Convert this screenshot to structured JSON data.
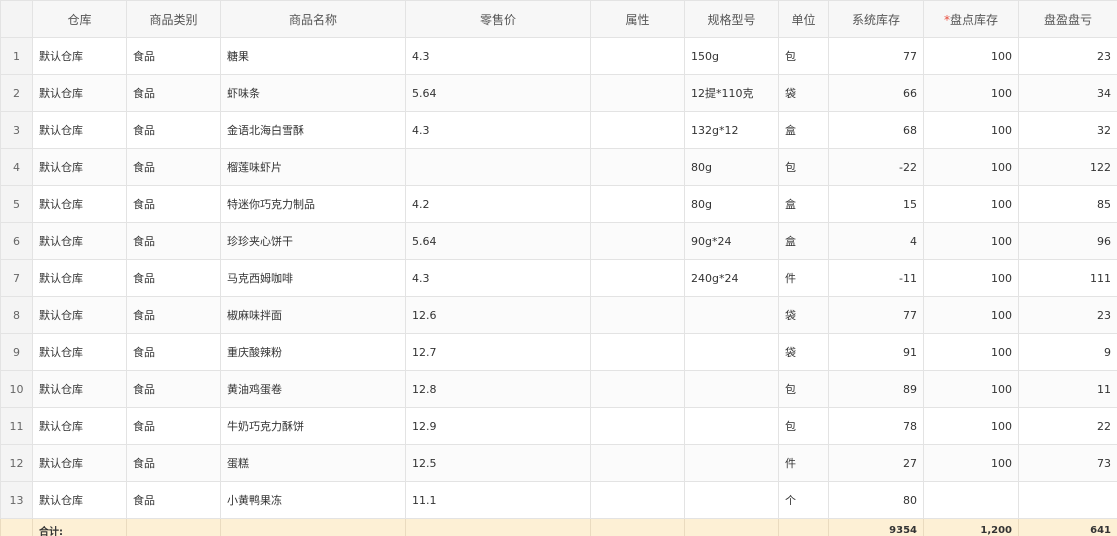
{
  "headers": {
    "warehouse": "仓库",
    "category": "商品类别",
    "name": "商品名称",
    "price": "零售价",
    "attribute": "属性",
    "spec": "规格型号",
    "unit": "单位",
    "system_stock": "系统库存",
    "required_mark": "*",
    "count_stock": "盘点库存",
    "diff": "盘盈盘亏"
  },
  "rows": [
    {
      "n": "1",
      "warehouse": "默认仓库",
      "category": "食品",
      "name": "糖果",
      "price": "4.3",
      "attribute": "",
      "spec": "150g",
      "unit": "包",
      "system_stock": "77",
      "count_stock": "100",
      "diff": "23"
    },
    {
      "n": "2",
      "warehouse": "默认仓库",
      "category": "食品",
      "name": "虾味条",
      "price": "5.64",
      "attribute": "",
      "spec": "12提*110克",
      "unit": "袋",
      "system_stock": "66",
      "count_stock": "100",
      "diff": "34"
    },
    {
      "n": "3",
      "warehouse": "默认仓库",
      "category": "食品",
      "name": "金语北海白雪酥",
      "price": "4.3",
      "attribute": "",
      "spec": "132g*12",
      "unit": "盒",
      "system_stock": "68",
      "count_stock": "100",
      "diff": "32"
    },
    {
      "n": "4",
      "warehouse": "默认仓库",
      "category": "食品",
      "name": "榴莲味虾片",
      "price": "",
      "attribute": "",
      "spec": "80g",
      "unit": "包",
      "system_stock": "-22",
      "count_stock": "100",
      "diff": "122"
    },
    {
      "n": "5",
      "warehouse": "默认仓库",
      "category": "食品",
      "name": "特迷你巧克力制品",
      "price": "4.2",
      "attribute": "",
      "spec": "80g",
      "unit": "盒",
      "system_stock": "15",
      "count_stock": "100",
      "diff": "85"
    },
    {
      "n": "6",
      "warehouse": "默认仓库",
      "category": "食品",
      "name": "珍珍夹心饼干",
      "price": "5.64",
      "attribute": "",
      "spec": "90g*24",
      "unit": "盒",
      "system_stock": "4",
      "count_stock": "100",
      "diff": "96"
    },
    {
      "n": "7",
      "warehouse": "默认仓库",
      "category": "食品",
      "name": "马克西姆咖啡",
      "price": "4.3",
      "attribute": "",
      "spec": "240g*24",
      "unit": "件",
      "system_stock": "-11",
      "count_stock": "100",
      "diff": "111"
    },
    {
      "n": "8",
      "warehouse": "默认仓库",
      "category": "食品",
      "name": "椒麻味拌面",
      "price": "12.6",
      "attribute": "",
      "spec": "",
      "unit": "袋",
      "system_stock": "77",
      "count_stock": "100",
      "diff": "23"
    },
    {
      "n": "9",
      "warehouse": "默认仓库",
      "category": "食品",
      "name": "重庆酸辣粉",
      "price": "12.7",
      "attribute": "",
      "spec": "",
      "unit": "袋",
      "system_stock": "91",
      "count_stock": "100",
      "diff": "9"
    },
    {
      "n": "10",
      "warehouse": "默认仓库",
      "category": "食品",
      "name": "黄油鸡蛋卷",
      "price": "12.8",
      "attribute": "",
      "spec": "",
      "unit": "包",
      "system_stock": "89",
      "count_stock": "100",
      "diff": "11"
    },
    {
      "n": "11",
      "warehouse": "默认仓库",
      "category": "食品",
      "name": "牛奶巧克力酥饼",
      "price": "12.9",
      "attribute": "",
      "spec": "",
      "unit": "包",
      "system_stock": "78",
      "count_stock": "100",
      "diff": "22"
    },
    {
      "n": "12",
      "warehouse": "默认仓库",
      "category": "食品",
      "name": "蛋糕",
      "price": "12.5",
      "attribute": "",
      "spec": "",
      "unit": "件",
      "system_stock": "27",
      "count_stock": "100",
      "diff": "73"
    },
    {
      "n": "13",
      "warehouse": "默认仓库",
      "category": "食品",
      "name": "小黄鸭果冻",
      "price": "11.1",
      "attribute": "",
      "spec": "",
      "unit": "个",
      "system_stock": "80",
      "count_stock": "",
      "diff": ""
    }
  ],
  "footer": {
    "label": "合计:",
    "system_stock_total": "9354",
    "count_stock_total": "1,200",
    "diff_total": "641"
  }
}
